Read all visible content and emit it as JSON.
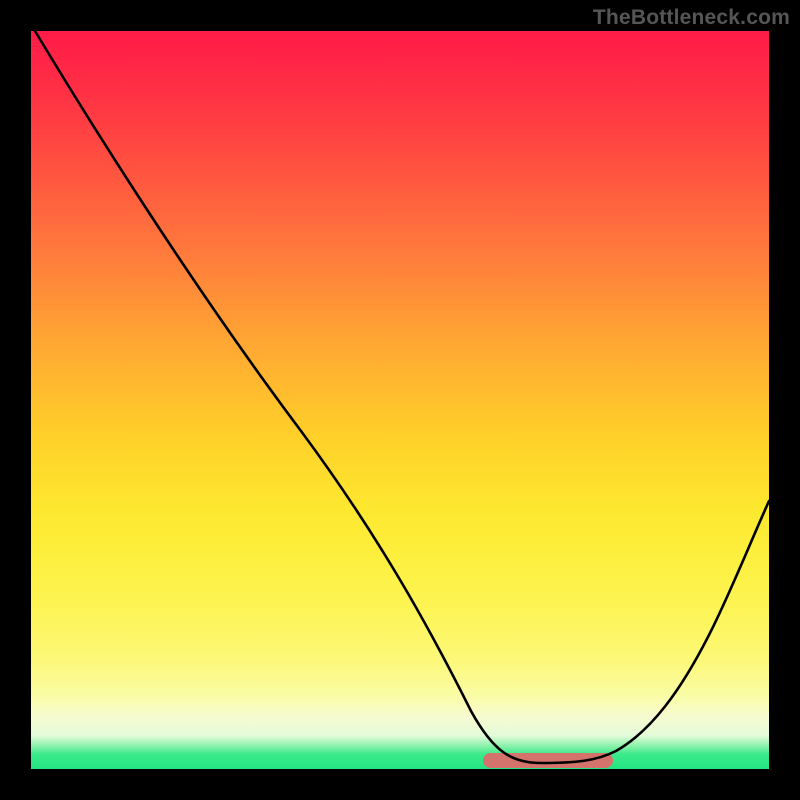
{
  "watermark": "TheBottleneck.com",
  "chart_data": {
    "type": "line",
    "title": "",
    "xlabel": "",
    "ylabel": "",
    "xlim": [
      0,
      100
    ],
    "ylim": [
      0,
      100
    ],
    "grid": false,
    "legend": false,
    "background_gradient": {
      "top": "#ff1b47",
      "mid": "#ffe030",
      "bottom": "#23e581"
    },
    "series": [
      {
        "name": "bottleneck-curve",
        "color": "#000000",
        "x": [
          0,
          3,
          10,
          20,
          30,
          40,
          50,
          55,
          61,
          66,
          72,
          79,
          85,
          92,
          100
        ],
        "values": [
          100,
          97,
          87,
          73,
          59,
          45,
          31,
          21,
          10,
          3,
          0,
          1,
          8,
          18,
          35
        ]
      }
    ],
    "annotations": [
      {
        "name": "optimal-region",
        "shape": "pill",
        "x_start": 61,
        "x_end": 79,
        "y": 0.5,
        "color": "#d4736b"
      }
    ]
  }
}
